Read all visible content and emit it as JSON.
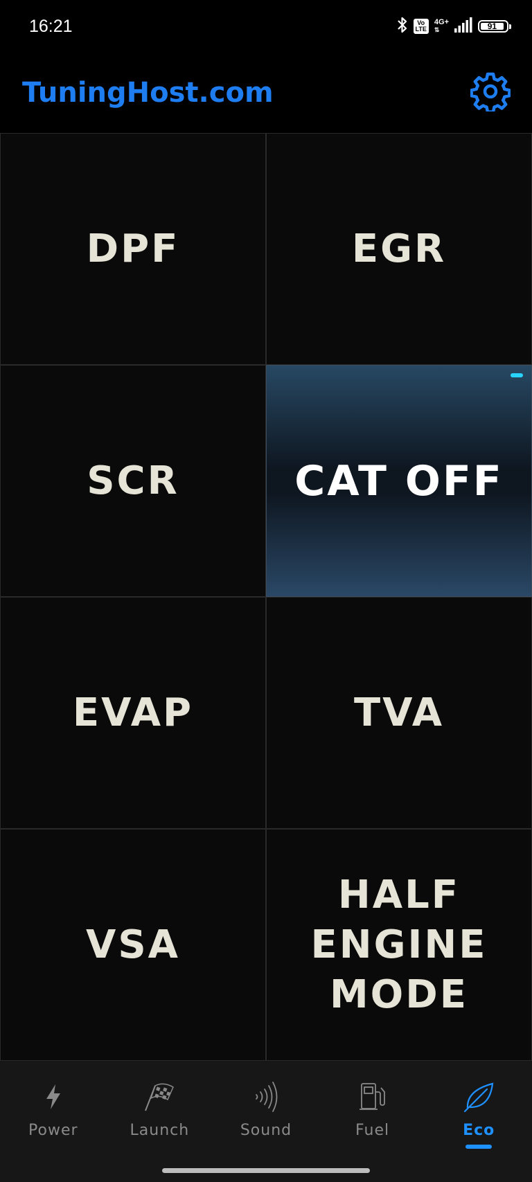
{
  "status_bar": {
    "time": "16:21",
    "volte": "Vo\nLTE",
    "network": "4G+",
    "battery_level": "91",
    "battery_fraction": 0.91
  },
  "header": {
    "title": "TuningHost.com",
    "accent_color": "#1e7df0"
  },
  "tiles": [
    {
      "label": "DPF",
      "active": false
    },
    {
      "label": "EGR",
      "active": false
    },
    {
      "label": "SCR",
      "active": false
    },
    {
      "label": "CAT OFF",
      "active": true
    },
    {
      "label": "EVAP",
      "active": false
    },
    {
      "label": "TVA",
      "active": false
    },
    {
      "label": "VSA",
      "active": false
    },
    {
      "label": "HALF\nENGINE\nMODE",
      "active": false
    }
  ],
  "nav": {
    "items": [
      {
        "label": "Power",
        "icon": "lightning-icon"
      },
      {
        "label": "Launch",
        "icon": "checkered-flag-icon"
      },
      {
        "label": "Sound",
        "icon": "sound-waves-icon"
      },
      {
        "label": "Fuel",
        "icon": "fuel-pump-icon"
      },
      {
        "label": "Eco",
        "icon": "leaf-icon"
      }
    ],
    "active_index": 4,
    "active_color": "#1e90ff"
  }
}
